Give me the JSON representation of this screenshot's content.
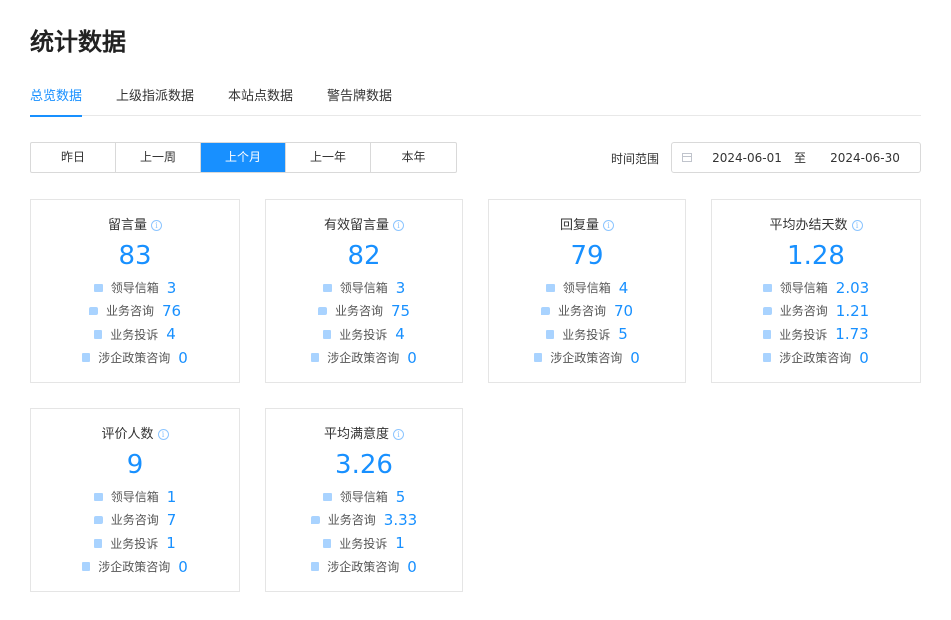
{
  "page": {
    "title": "统计数据"
  },
  "tabs": [
    {
      "label": "总览数据",
      "active": true
    },
    {
      "label": "上级指派数据",
      "active": false
    },
    {
      "label": "本站点数据",
      "active": false
    },
    {
      "label": "警告牌数据",
      "active": false
    }
  ],
  "time_ranges": [
    {
      "label": "昨日",
      "active": false
    },
    {
      "label": "上一周",
      "active": false
    },
    {
      "label": "上个月",
      "active": true
    },
    {
      "label": "上一年",
      "active": false
    },
    {
      "label": "本年",
      "active": false
    }
  ],
  "date_range": {
    "label": "时间范围",
    "start": "2024-06-01",
    "separator": "至",
    "end": "2024-06-30"
  },
  "colors": {
    "accent": "#1890ff",
    "icon": "#a9d3ff"
  },
  "cards": [
    {
      "title": "留言量",
      "value": "83",
      "rows": [
        {
          "icon": "mail-icon",
          "label": "领导信箱",
          "value": "3"
        },
        {
          "icon": "chat-icon",
          "label": "业务咨询",
          "value": "76"
        },
        {
          "icon": "document-icon",
          "label": "业务投诉",
          "value": "4"
        },
        {
          "icon": "file-icon",
          "label": "涉企政策咨询",
          "value": "0"
        }
      ]
    },
    {
      "title": "有效留言量",
      "value": "82",
      "rows": [
        {
          "icon": "mail-icon",
          "label": "领导信箱",
          "value": "3"
        },
        {
          "icon": "chat-icon",
          "label": "业务咨询",
          "value": "75"
        },
        {
          "icon": "document-icon",
          "label": "业务投诉",
          "value": "4"
        },
        {
          "icon": "file-icon",
          "label": "涉企政策咨询",
          "value": "0"
        }
      ]
    },
    {
      "title": "回复量",
      "value": "79",
      "rows": [
        {
          "icon": "mail-icon",
          "label": "领导信箱",
          "value": "4"
        },
        {
          "icon": "chat-icon",
          "label": "业务咨询",
          "value": "70"
        },
        {
          "icon": "document-icon",
          "label": "业务投诉",
          "value": "5"
        },
        {
          "icon": "file-icon",
          "label": "涉企政策咨询",
          "value": "0"
        }
      ]
    },
    {
      "title": "平均办结天数",
      "value": "1.28",
      "rows": [
        {
          "icon": "mail-icon",
          "label": "领导信箱",
          "value": "2.03"
        },
        {
          "icon": "chat-icon",
          "label": "业务咨询",
          "value": "1.21"
        },
        {
          "icon": "document-icon",
          "label": "业务投诉",
          "value": "1.73"
        },
        {
          "icon": "file-icon",
          "label": "涉企政策咨询",
          "value": "0"
        }
      ]
    },
    {
      "title": "评价人数",
      "value": "9",
      "rows": [
        {
          "icon": "mail-icon",
          "label": "领导信箱",
          "value": "1"
        },
        {
          "icon": "chat-icon",
          "label": "业务咨询",
          "value": "7"
        },
        {
          "icon": "document-icon",
          "label": "业务投诉",
          "value": "1"
        },
        {
          "icon": "file-icon",
          "label": "涉企政策咨询",
          "value": "0"
        }
      ]
    },
    {
      "title": "平均满意度",
      "value": "3.26",
      "rows": [
        {
          "icon": "mail-icon",
          "label": "领导信箱",
          "value": "5"
        },
        {
          "icon": "chat-icon",
          "label": "业务咨询",
          "value": "3.33"
        },
        {
          "icon": "document-icon",
          "label": "业务投诉",
          "value": "1"
        },
        {
          "icon": "file-icon",
          "label": "涉企政策咨询",
          "value": "0"
        }
      ]
    }
  ]
}
